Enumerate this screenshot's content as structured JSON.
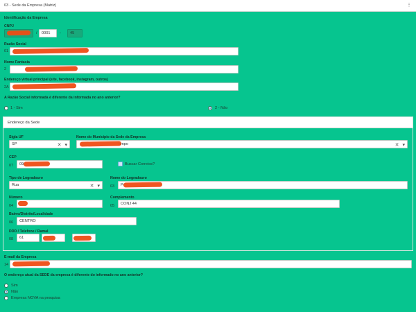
{
  "header": {
    "title": "03 - Sede da Empresa (Matriz)",
    "options_icon": "more-dots-icon",
    "options_glyph": "⋮"
  },
  "identification": {
    "section_label": "Identificação da Empresa",
    "cnpj_label": "CNPJ",
    "cnpj_part2": "0001",
    "cnpj_part3": "45",
    "sep1": "/",
    "sep2": "-",
    "razao_label": "Razão Social",
    "razao_num": "01",
    "fantasia_label": "Nome Fantasia",
    "fantasia_num": "2",
    "web_label": "Endereço virtual principal (site, facebook, instagram, outros)",
    "web_num": "2A"
  },
  "razao_question": {
    "text": "A Razão Social informada é diferente da informada no ano anterior?",
    "opt1": "1 - Sim",
    "opt2": "2 - Não",
    "selected": "2 - Não"
  },
  "address": {
    "panel_title": "Endereço da Sede",
    "uf_label": "Sigla UF",
    "uf_value": "SP",
    "municipio_label": "Nome do Município da Sede da Empresa",
    "municipio_visible": "ampo",
    "cep_label": "CEP",
    "cep_num": "07",
    "cep_visible": "09",
    "buscar_label": "Buscar Correios?",
    "tipo_label": "Tipo de Logradouro",
    "tipo_num": "02",
    "tipo_value": "Rua",
    "nome_log_label": "Nome do Logradouro",
    "nome_log_num": "03",
    "nome_log_visible": "Pr",
    "numero_label": "Número",
    "numero_num": "04",
    "compl_label": "Complemento",
    "compl_num": "05",
    "compl_value": "CONJ 44",
    "bairro_label": "Bairro/Distrito/Localidade",
    "bairro_num": "06",
    "bairro_value": "CENTRO",
    "ddd_label": "DDD / Telefone / Ramal",
    "ddd_num": "08",
    "ddd_value": "61",
    "clear_glyph": "✕",
    "dropdown_glyph": "▾"
  },
  "email": {
    "label": "E-mail da Empresa",
    "num": "14"
  },
  "sede_question": {
    "text": "O endereço atual da SEDE da empresa é diferente do informado no ano anterior?",
    "opt1": "Sim",
    "opt2": "Não",
    "opt3": "Empresa NOVA na pesquisa",
    "selected": "Não"
  },
  "colors": {
    "background": "#06c58f",
    "redaction": "#ef4c14",
    "radio_selected": "#2f8cd6"
  }
}
